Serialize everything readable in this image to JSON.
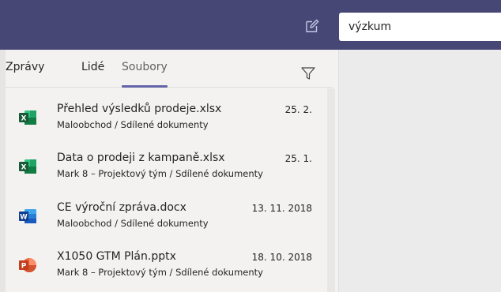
{
  "header": {
    "compose_icon": "compose-icon",
    "search": {
      "value": "výzkum",
      "icon": ""
    },
    "colors": {
      "bar": "#464775",
      "accent": "#6264a7"
    }
  },
  "tabs": [
    {
      "label": "Zprávy",
      "active": false
    },
    {
      "label": "Lidé",
      "active": false
    },
    {
      "label": "Soubory",
      "active": true
    }
  ],
  "filter_icon": "filter-icon",
  "files": [
    {
      "type": "xlsx",
      "icon": "excel-icon",
      "name": "Přehled výsledků prodeje.xlsx",
      "path": "Maloobchod / Sdílené dokumenty",
      "date": "25. 2."
    },
    {
      "type": "xlsx",
      "icon": "excel-icon",
      "name": "Data o prodeji z kampaně.xlsx",
      "path": "Mark 8 – Projektový tým / Sdílené dokumenty",
      "date": "25. 1."
    },
    {
      "type": "docx",
      "icon": "word-icon",
      "name": "CE výroční zpráva.docx",
      "path": "Maloobchod / Sdílené dokumenty",
      "date": "13. 11. 2018"
    },
    {
      "type": "pptx",
      "icon": "powerpoint-icon",
      "name": "X1050 GTM Plán.pptx",
      "path": "Mark 8 – Projektový tým / Sdílené dokumenty",
      "date": "18. 10. 2018"
    }
  ]
}
